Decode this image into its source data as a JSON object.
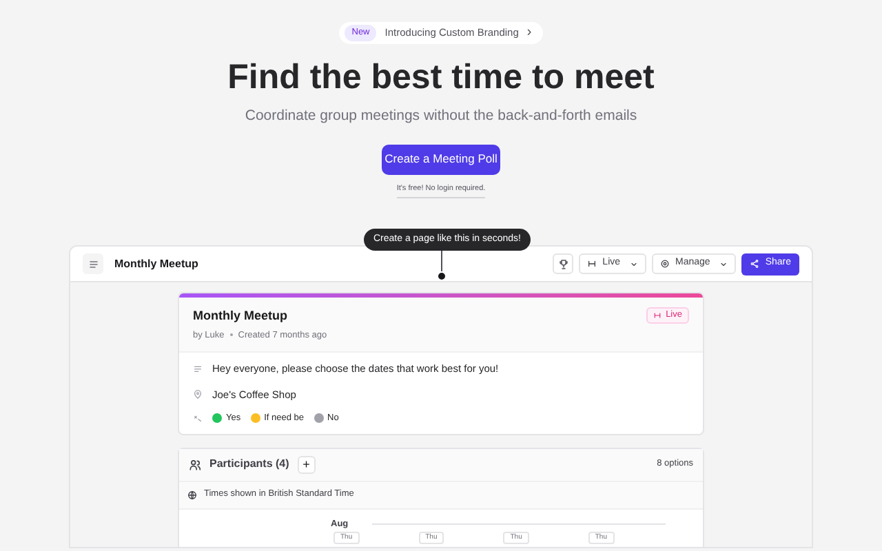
{
  "announcement": {
    "badge": "New",
    "text": "Introducing Custom Branding",
    "arrow": "›"
  },
  "hero": {
    "title": "Find the best time to meet",
    "subtitle": "Coordinate group meetings without the back-and-forth emails",
    "cta": "Create a Meeting Poll",
    "note": "It's free! No login required."
  },
  "tooltip": "Create a page like this in seconds!",
  "app_bar": {
    "title": "Monthly Meetup",
    "status": "Live",
    "manage": "Manage",
    "share": "Share"
  },
  "poll": {
    "title": "Monthly Meetup",
    "author": "by Luke",
    "created": "Created 7 months ago",
    "status": "Live",
    "description": "Hey everyone, please choose the dates that work best for you!",
    "location": "Joe's Coffee Shop",
    "legend": [
      {
        "label": "Yes",
        "color": "#22c55e"
      },
      {
        "label": "If need be",
        "color": "#fbbf24"
      },
      {
        "label": "No",
        "color": "#a1a1aa"
      }
    ]
  },
  "participants": {
    "title": "Participants (4)",
    "add": "+",
    "options": "8 options",
    "timezone": "Times shown in British Standard Time",
    "month": "Aug",
    "days": [
      "Thu",
      "Thu",
      "Thu",
      "Thu"
    ]
  }
}
